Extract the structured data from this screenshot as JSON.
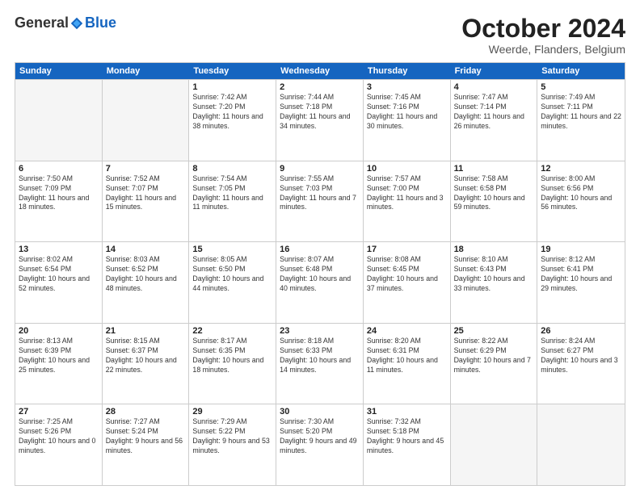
{
  "header": {
    "logo_general": "General",
    "logo_blue": "Blue",
    "month_title": "October 2024",
    "location": "Weerde, Flanders, Belgium"
  },
  "days_of_week": [
    "Sunday",
    "Monday",
    "Tuesday",
    "Wednesday",
    "Thursday",
    "Friday",
    "Saturday"
  ],
  "weeks": [
    [
      {
        "day": "",
        "empty": true
      },
      {
        "day": "",
        "empty": true
      },
      {
        "day": "1",
        "sunrise": "7:42 AM",
        "sunset": "7:20 PM",
        "daylight": "11 hours and 38 minutes."
      },
      {
        "day": "2",
        "sunrise": "7:44 AM",
        "sunset": "7:18 PM",
        "daylight": "11 hours and 34 minutes."
      },
      {
        "day": "3",
        "sunrise": "7:45 AM",
        "sunset": "7:16 PM",
        "daylight": "11 hours and 30 minutes."
      },
      {
        "day": "4",
        "sunrise": "7:47 AM",
        "sunset": "7:14 PM",
        "daylight": "11 hours and 26 minutes."
      },
      {
        "day": "5",
        "sunrise": "7:49 AM",
        "sunset": "7:11 PM",
        "daylight": "11 hours and 22 minutes."
      }
    ],
    [
      {
        "day": "6",
        "sunrise": "7:50 AM",
        "sunset": "7:09 PM",
        "daylight": "11 hours and 18 minutes."
      },
      {
        "day": "7",
        "sunrise": "7:52 AM",
        "sunset": "7:07 PM",
        "daylight": "11 hours and 15 minutes."
      },
      {
        "day": "8",
        "sunrise": "7:54 AM",
        "sunset": "7:05 PM",
        "daylight": "11 hours and 11 minutes."
      },
      {
        "day": "9",
        "sunrise": "7:55 AM",
        "sunset": "7:03 PM",
        "daylight": "11 hours and 7 minutes."
      },
      {
        "day": "10",
        "sunrise": "7:57 AM",
        "sunset": "7:00 PM",
        "daylight": "11 hours and 3 minutes."
      },
      {
        "day": "11",
        "sunrise": "7:58 AM",
        "sunset": "6:58 PM",
        "daylight": "10 hours and 59 minutes."
      },
      {
        "day": "12",
        "sunrise": "8:00 AM",
        "sunset": "6:56 PM",
        "daylight": "10 hours and 56 minutes."
      }
    ],
    [
      {
        "day": "13",
        "sunrise": "8:02 AM",
        "sunset": "6:54 PM",
        "daylight": "10 hours and 52 minutes."
      },
      {
        "day": "14",
        "sunrise": "8:03 AM",
        "sunset": "6:52 PM",
        "daylight": "10 hours and 48 minutes."
      },
      {
        "day": "15",
        "sunrise": "8:05 AM",
        "sunset": "6:50 PM",
        "daylight": "10 hours and 44 minutes."
      },
      {
        "day": "16",
        "sunrise": "8:07 AM",
        "sunset": "6:48 PM",
        "daylight": "10 hours and 40 minutes."
      },
      {
        "day": "17",
        "sunrise": "8:08 AM",
        "sunset": "6:45 PM",
        "daylight": "10 hours and 37 minutes."
      },
      {
        "day": "18",
        "sunrise": "8:10 AM",
        "sunset": "6:43 PM",
        "daylight": "10 hours and 33 minutes."
      },
      {
        "day": "19",
        "sunrise": "8:12 AM",
        "sunset": "6:41 PM",
        "daylight": "10 hours and 29 minutes."
      }
    ],
    [
      {
        "day": "20",
        "sunrise": "8:13 AM",
        "sunset": "6:39 PM",
        "daylight": "10 hours and 25 minutes."
      },
      {
        "day": "21",
        "sunrise": "8:15 AM",
        "sunset": "6:37 PM",
        "daylight": "10 hours and 22 minutes."
      },
      {
        "day": "22",
        "sunrise": "8:17 AM",
        "sunset": "6:35 PM",
        "daylight": "10 hours and 18 minutes."
      },
      {
        "day": "23",
        "sunrise": "8:18 AM",
        "sunset": "6:33 PM",
        "daylight": "10 hours and 14 minutes."
      },
      {
        "day": "24",
        "sunrise": "8:20 AM",
        "sunset": "6:31 PM",
        "daylight": "10 hours and 11 minutes."
      },
      {
        "day": "25",
        "sunrise": "8:22 AM",
        "sunset": "6:29 PM",
        "daylight": "10 hours and 7 minutes."
      },
      {
        "day": "26",
        "sunrise": "8:24 AM",
        "sunset": "6:27 PM",
        "daylight": "10 hours and 3 minutes."
      }
    ],
    [
      {
        "day": "27",
        "sunrise": "7:25 AM",
        "sunset": "5:26 PM",
        "daylight": "10 hours and 0 minutes."
      },
      {
        "day": "28",
        "sunrise": "7:27 AM",
        "sunset": "5:24 PM",
        "daylight": "9 hours and 56 minutes."
      },
      {
        "day": "29",
        "sunrise": "7:29 AM",
        "sunset": "5:22 PM",
        "daylight": "9 hours and 53 minutes."
      },
      {
        "day": "30",
        "sunrise": "7:30 AM",
        "sunset": "5:20 PM",
        "daylight": "9 hours and 49 minutes."
      },
      {
        "day": "31",
        "sunrise": "7:32 AM",
        "sunset": "5:18 PM",
        "daylight": "9 hours and 45 minutes."
      },
      {
        "day": "",
        "empty": true
      },
      {
        "day": "",
        "empty": true
      }
    ]
  ]
}
